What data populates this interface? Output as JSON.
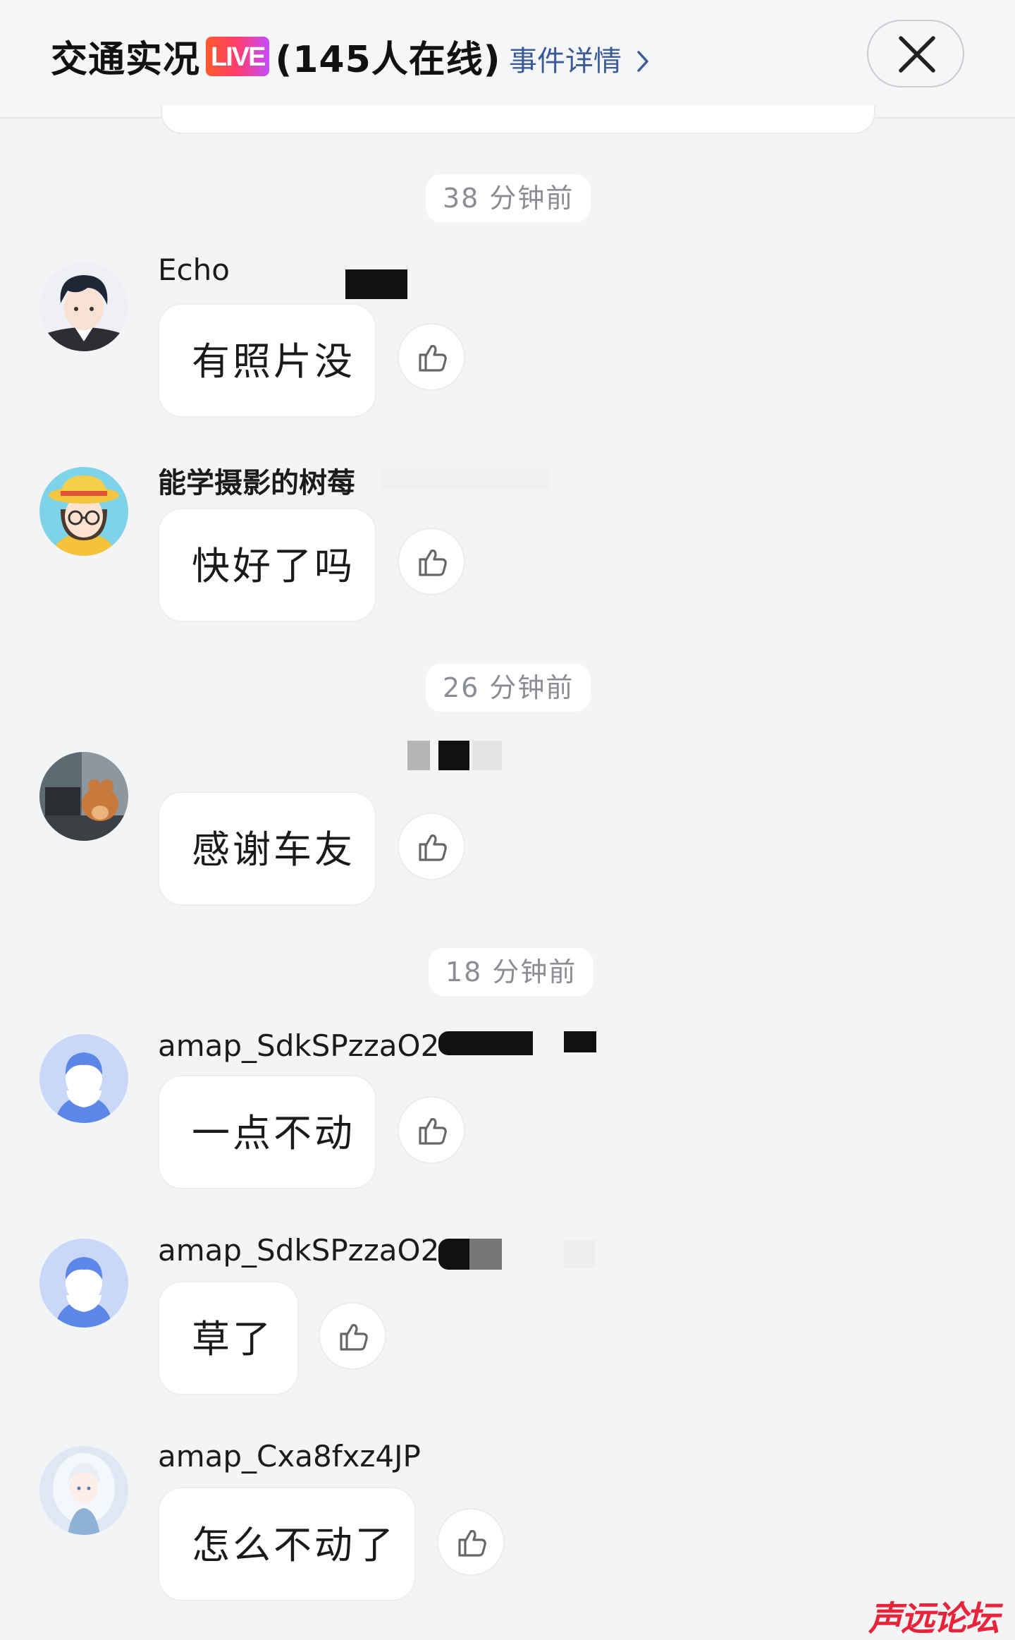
{
  "header": {
    "title_main": "交通实况",
    "live_badge": "LIVE",
    "online": "(145人在线)",
    "details_link": "事件详情",
    "close_icon": "close-icon"
  },
  "time_groups": [
    "38 分钟前",
    "26 分钟前",
    "18 分钟前"
  ],
  "messages": [
    {
      "user": "Echo",
      "text": "有照片没",
      "avatar": "anime-boy-avatar"
    },
    {
      "user": "能学摄影的树莓",
      "text": "快好了吗",
      "avatar": "straw-hat-girl-avatar"
    },
    {
      "user": "",
      "text": "感谢车友",
      "avatar": "photo-avatar"
    },
    {
      "user": "amap_SdkSPzzaO2",
      "text": "一点不动",
      "avatar": "default-person-avatar"
    },
    {
      "user": "amap_SdkSPzzaO2",
      "text": "草了",
      "avatar": "default-person-avatar"
    },
    {
      "user": "amap_Cxa8fxz4JP",
      "text": "怎么不动了",
      "avatar": "anime-white-hair-avatar"
    }
  ],
  "like_icon": "thumbs-up-icon",
  "watermark": "声远论坛",
  "colors": {
    "accent_link": "#3b5a97",
    "background": "#f3f4f6",
    "watermark": "#e8243a"
  }
}
